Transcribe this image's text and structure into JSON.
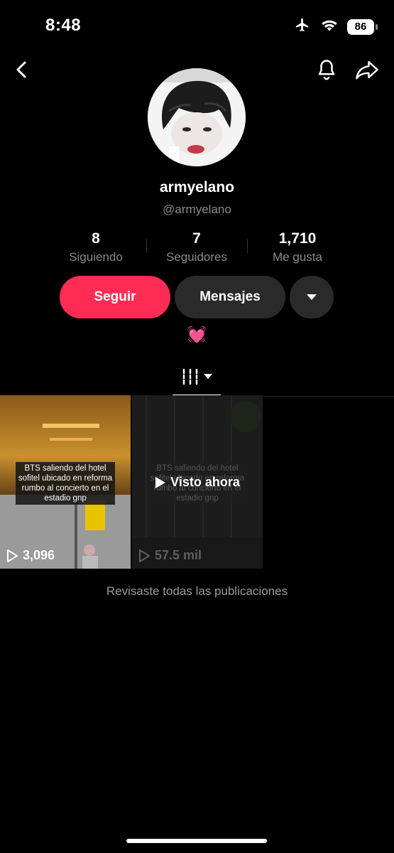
{
  "status": {
    "time": "8:48",
    "battery": "86"
  },
  "profile": {
    "username": "armyelano",
    "handle": "@armyelano",
    "bio_emoji": "💓"
  },
  "stats": [
    {
      "value": "8",
      "label": "Siguiendo"
    },
    {
      "value": "7",
      "label": "Seguidores"
    },
    {
      "value": "1,710",
      "label": "Me gusta"
    }
  ],
  "actions": {
    "follow": "Seguir",
    "message": "Mensajes"
  },
  "videos": [
    {
      "caption": "BTS saliendo del hotel sofitel ubicado en reforma rumbo al concierto en el estadio gnp",
      "views": "3,096"
    },
    {
      "caption": "BTS saliendo del hotel sofitel ubicado en reforma rumbo al concierto en el estadio gnp",
      "views": "57.5 mil",
      "overlay": "Visto ahora"
    }
  ],
  "footer_text": "Revisaste todas las publicaciones",
  "colors": {
    "accent": "#fe2c55",
    "background": "#000000"
  }
}
